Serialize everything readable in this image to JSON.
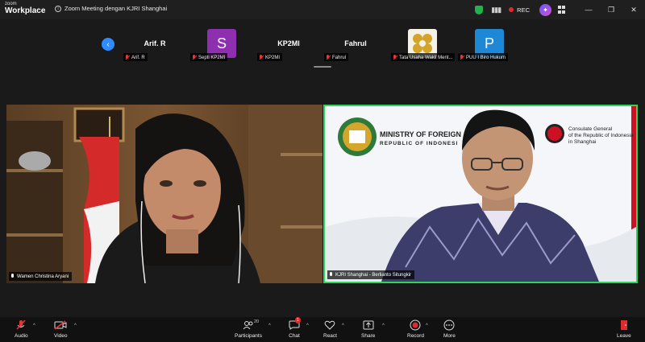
{
  "app": {
    "brand_small": "zoom",
    "brand_big": "Workplace",
    "meeting_title": "Zoom Meeting dengan KJRI Shanghai",
    "rec_label": "REC"
  },
  "thumbnails": [
    {
      "name": "Arif. R",
      "label": "Arif. R",
      "type": "name"
    },
    {
      "initial": "S",
      "label": "Septi KP2MI",
      "type": "avatar",
      "color": "#8e2fb0"
    },
    {
      "name": "KP2MI",
      "label": "KP2MI",
      "type": "name"
    },
    {
      "name": "Fahrul",
      "label": "Fahrul",
      "type": "name"
    },
    {
      "label": "Tata Usaha Wakil Ment...",
      "type": "logo"
    },
    {
      "initial": "P",
      "label": "PUU I Biro Hukum",
      "type": "avatar",
      "color": "#1e88d6"
    }
  ],
  "tiles": {
    "left": {
      "label": "Wamen Christina Aryani"
    },
    "right": {
      "label": "KJRI Shanghai - Berlianto Situngkir",
      "ministry_line1": "MINISTRY OF FOREIGN",
      "ministry_line2": "REPUBLIC OF INDONESI",
      "consulate_line1": "Consulate General",
      "consulate_line2": "of the Republic of Indonesia",
      "consulate_line3": "in Shanghai"
    }
  },
  "toolbar": {
    "audio": "Audio",
    "video": "Video",
    "participants": "Participants",
    "participants_count": "20",
    "chat": "Chat",
    "chat_badge": "1",
    "react": "React",
    "share": "Share",
    "record": "Record",
    "more": "More",
    "leave": "Leave"
  },
  "colors": {
    "accent": "#2d8cff",
    "active_speaker": "#2fd45a",
    "rec": "#e02b2b"
  }
}
